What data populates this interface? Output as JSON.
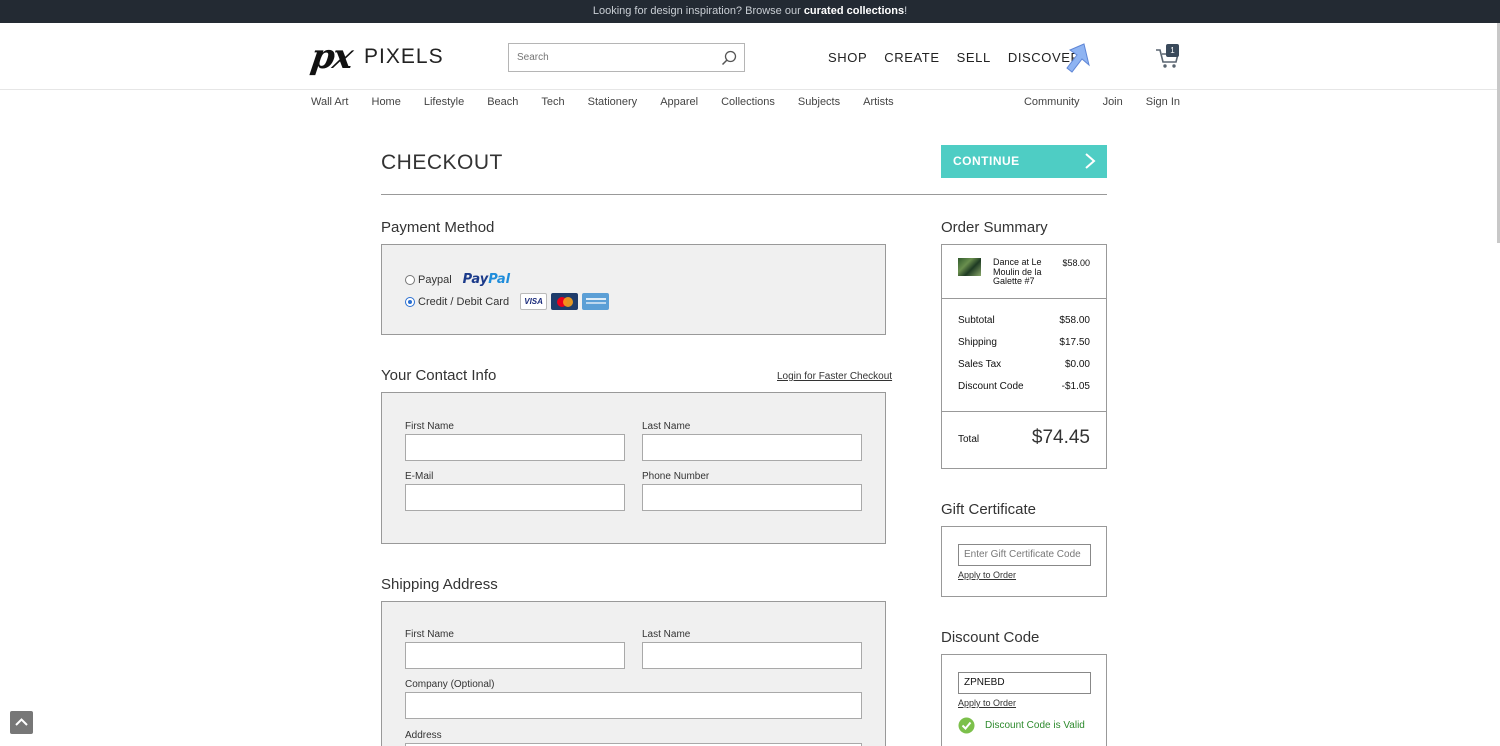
{
  "topbar": {
    "text": "Looking for design inspiration?   Browse our ",
    "link": "curated collections",
    "end": "!"
  },
  "header": {
    "logo_mark": "px",
    "logo_word": "PIXELS",
    "search_placeholder": "Search",
    "nav": [
      "SHOP",
      "CREATE",
      "SELL",
      "DISCOVER"
    ],
    "cart_count": "1"
  },
  "subnav": {
    "left": [
      "Wall Art",
      "Home",
      "Lifestyle",
      "Beach",
      "Tech",
      "Stationery",
      "Apparel",
      "Collections",
      "Subjects",
      "Artists"
    ],
    "right": [
      "Community",
      "Join",
      "Sign In"
    ]
  },
  "checkout": {
    "title": "CHECKOUT",
    "continue_label": "CONTINUE"
  },
  "payment": {
    "title": "Payment Method",
    "options": [
      {
        "label": "Paypal",
        "checked": false
      },
      {
        "label": "Credit / Debit Card",
        "checked": true
      }
    ],
    "paypal_logo_a": "Pay",
    "paypal_logo_b": "Pal",
    "card_icons": [
      "visa-icon",
      "mastercard-icon",
      "amex-icon"
    ],
    "visa_text": "VISA"
  },
  "contact": {
    "title": "Your Contact Info",
    "login_link": "Login for Faster Checkout",
    "labels": {
      "first_name": "First Name",
      "last_name": "Last Name",
      "email": "E-Mail",
      "phone": "Phone Number"
    }
  },
  "shipping": {
    "title": "Shipping Address",
    "labels": {
      "first_name": "First Name",
      "last_name": "Last Name",
      "company": "Company (Optional)",
      "address": "Address"
    }
  },
  "summary": {
    "title": "Order Summary",
    "item": {
      "name": "Dance at Le Moulin de la Galette #7",
      "price": "$58.00"
    },
    "rows": [
      {
        "label": "Subtotal",
        "value": "$58.00"
      },
      {
        "label": "Shipping",
        "value": "$17.50"
      },
      {
        "label": "Sales Tax",
        "value": "$0.00"
      },
      {
        "label": "Discount Code",
        "value": "-$1.05"
      }
    ],
    "total_label": "Total",
    "total_value": "$74.45"
  },
  "gift": {
    "title": "Gift Certificate",
    "placeholder": "Enter Gift Certificate Code",
    "apply": "Apply to Order"
  },
  "discount": {
    "title": "Discount Code",
    "value": "ZPNEBD",
    "apply": "Apply to Order",
    "valid_text": "Discount Code is Valid"
  },
  "colors": {
    "accent": "#4ecdc4",
    "topbar": "#232a33",
    "panel": "#f0f0f0",
    "valid": "#2d8a2d"
  }
}
